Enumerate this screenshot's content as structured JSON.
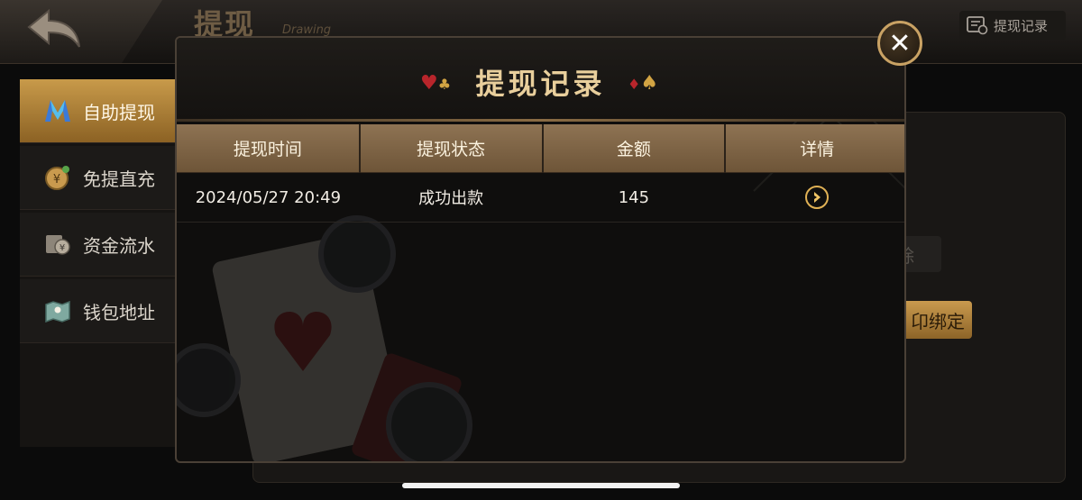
{
  "page": {
    "title": "提现",
    "subtitle": "Drawing",
    "records_link_label": "提现记录"
  },
  "sidebar": {
    "items": [
      {
        "label": "自助提现",
        "icon": "m-logo-icon",
        "active": true
      },
      {
        "label": "免提直充",
        "icon": "coin-icon",
        "active": false
      },
      {
        "label": "资金流水",
        "icon": "wallet-icon",
        "active": false
      },
      {
        "label": "钱包地址",
        "icon": "map-icon",
        "active": false
      }
    ]
  },
  "background_buttons": {
    "gray_partial": "除",
    "gold_partial": "卬绑定"
  },
  "modal": {
    "title": "提现记录",
    "columns": [
      "提现时间",
      "提现状态",
      "金额",
      "详情"
    ],
    "rows": [
      {
        "time": "2024/05/27 20:49",
        "status": "成功出款",
        "amount": "145",
        "detail_icon": "arrow-right-circle-icon"
      }
    ],
    "close_label": "✕"
  },
  "colors": {
    "accent_gold": "#c89a4a",
    "success_green": "#33c235",
    "header_brown": "#8e7353"
  }
}
